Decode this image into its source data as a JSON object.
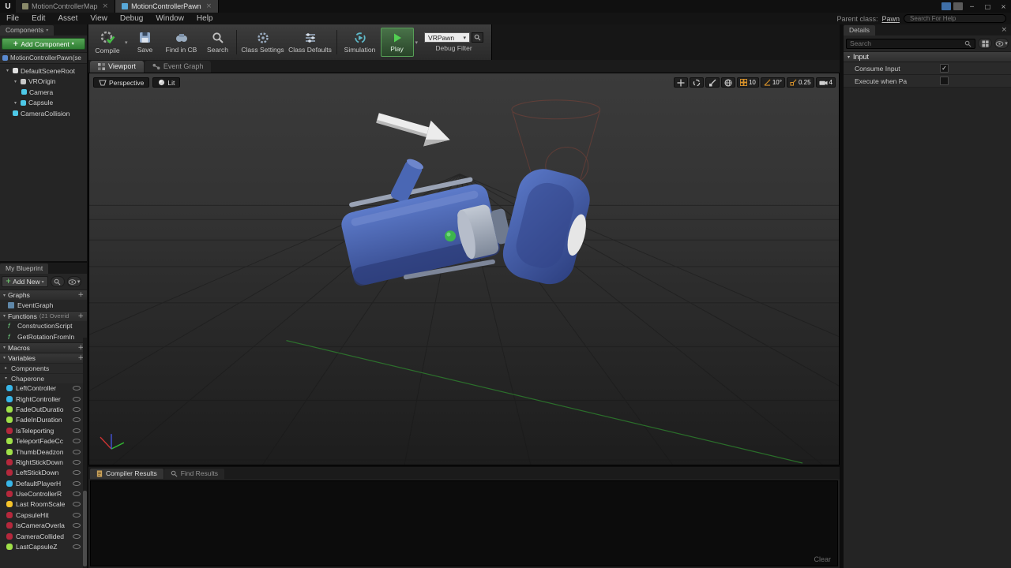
{
  "icons": {
    "caret_down": "▾",
    "caret_right": "▸",
    "close": "×",
    "plus": "+",
    "minimize": "─",
    "maximize": "□",
    "check": "✓"
  },
  "titlebar": {
    "tabs": [
      {
        "label": "MotionControllerMap"
      },
      {
        "label": "MotionControllerPawn"
      }
    ]
  },
  "menubar": {
    "items": [
      "File",
      "Edit",
      "Asset",
      "View",
      "Debug",
      "Window",
      "Help"
    ],
    "parent_class_label": "Parent class:",
    "parent_class_value": "Pawn",
    "help_search_placeholder": "Search For Help"
  },
  "components": {
    "header": "Components",
    "add_component_label": "Add Component",
    "self_item": "MotionControllerPawn(se",
    "tree": [
      {
        "label": "DefaultSceneRoot",
        "color": "#e0e0e0"
      },
      {
        "label": "VROrigin",
        "color": "#c8c8c8"
      },
      {
        "label": "Camera",
        "color": "#4ec9e8"
      },
      {
        "label": "Capsule",
        "color": "#4ec9e8"
      },
      {
        "label": "CameraCollision",
        "color": "#4ec9e8"
      }
    ]
  },
  "toolbar": {
    "compile": "Compile",
    "save": "Save",
    "find_in_cb": "Find in CB",
    "search": "Search",
    "class_settings": "Class Settings",
    "class_defaults": "Class Defaults",
    "simulation": "Simulation",
    "play": "Play",
    "debug_object": "VRPawn",
    "debug_filter_label": "Debug Filter"
  },
  "doc_tabs": {
    "tabs": [
      {
        "label": "Viewport"
      },
      {
        "label": "Event Graph"
      }
    ]
  },
  "viewport": {
    "perspective_label": "Perspective",
    "lit_label": "Lit",
    "grid_snap_value": "10",
    "angle_snap_value": "10°",
    "scale_snap_value": "0.25",
    "camera_speed_value": "4"
  },
  "my_blueprint": {
    "header": "My Blueprint",
    "add_new_label": "Add New",
    "graphs_header": "Graphs",
    "graph_items": [
      {
        "label": "EventGraph"
      }
    ],
    "functions_header": "Functions",
    "functions_note": "(21 Overrid",
    "function_items": [
      {
        "label": "ConstructionScript"
      },
      {
        "label": "GetRotationFromIn"
      }
    ],
    "macros_header": "Macros",
    "variables_header": "Variables",
    "categories": [
      {
        "label": "Components"
      },
      {
        "label": "Chaperone"
      }
    ],
    "variables": [
      {
        "label": "LeftController",
        "color": "#38b6e8"
      },
      {
        "label": "RightController",
        "color": "#38b6e8"
      },
      {
        "label": "FadeOutDuratio",
        "color": "#9fe048"
      },
      {
        "label": "FadeInDuration",
        "color": "#9fe048"
      },
      {
        "label": "IsTeleporting",
        "color": "#b5283c"
      },
      {
        "label": "TeleportFadeCc",
        "color": "#9fe048"
      },
      {
        "label": "ThumbDeadzon",
        "color": "#9fe048"
      },
      {
        "label": "RightStickDown",
        "color": "#b5283c"
      },
      {
        "label": "LeftStickDown",
        "color": "#b5283c"
      },
      {
        "label": "DefaultPlayerH",
        "color": "#38b6e8"
      },
      {
        "label": "UseControllerR",
        "color": "#b5283c"
      },
      {
        "label": "Last RoomScale",
        "color": "#f5c32a"
      },
      {
        "label": "CapsuleHit",
        "color": "#b5283c"
      },
      {
        "label": "IsCameraOverla",
        "color": "#b5283c"
      },
      {
        "label": "CameraCollided",
        "color": "#b5283c"
      },
      {
        "label": "LastCapsuleZ",
        "color": "#9fe048"
      }
    ]
  },
  "bottom": {
    "tabs": [
      {
        "label": "Compiler Results"
      },
      {
        "label": "Find Results"
      }
    ],
    "clear_label": "Clear"
  },
  "details": {
    "header": "Details",
    "search_placeholder": "Search",
    "section_label": "Input",
    "rows": [
      {
        "label": "Consume Input",
        "checked": true
      },
      {
        "label": "Execute when Pa",
        "checked": false
      }
    ]
  }
}
